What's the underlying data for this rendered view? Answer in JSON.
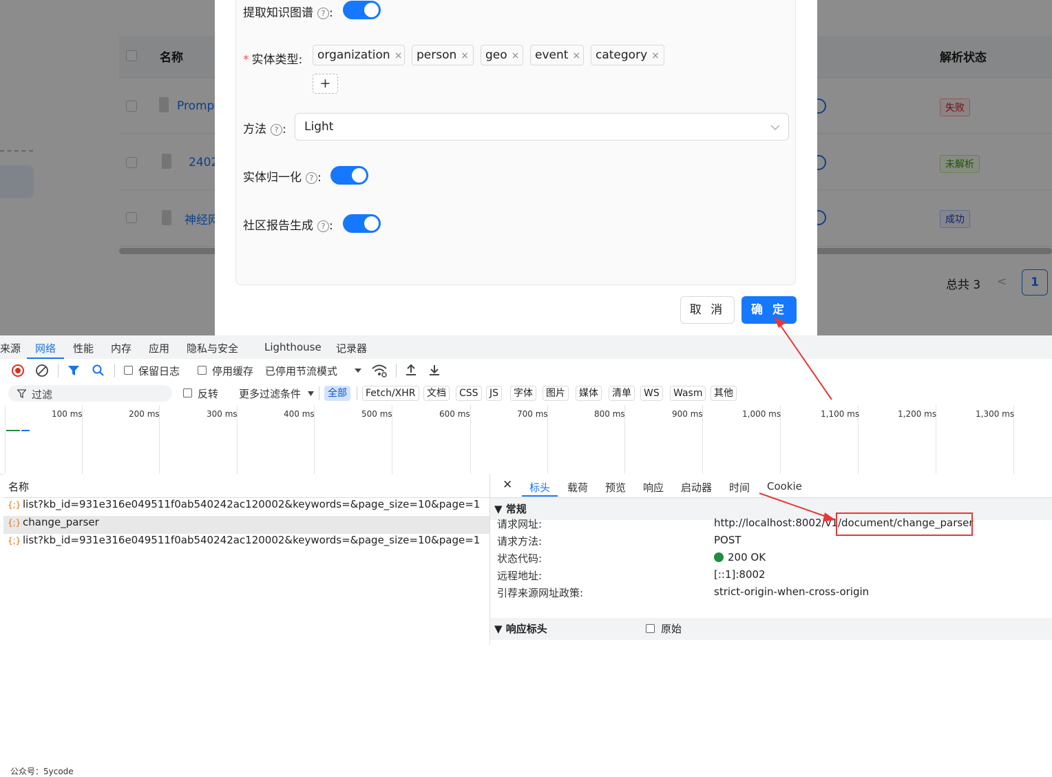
{
  "background": {
    "header": {
      "name_col": "名称",
      "status_col": "解析状态"
    },
    "rows": [
      {
        "name": "Prompt",
        "status": "失败"
      },
      {
        "name": "2402",
        "status": "未解析"
      },
      {
        "name": "神经网",
        "status": "成功"
      }
    ],
    "pager": {
      "total": "总共 3",
      "prev": "<",
      "current": "1"
    }
  },
  "modal": {
    "extract_kg": {
      "label": "提取知识图谱",
      "help": "?",
      "colon": ":",
      "enabled": true
    },
    "entity_types": {
      "label": "实体类型",
      "required": "*",
      "colon": ":",
      "tags": [
        "organization",
        "person",
        "geo",
        "event",
        "category"
      ],
      "remove_glyph": "×",
      "add_glyph": "+"
    },
    "method": {
      "label": "方法",
      "help": "?",
      "colon": ":",
      "value": "Light"
    },
    "entity_normalize": {
      "label": "实体归一化",
      "help": "?",
      "colon": ":",
      "enabled": true
    },
    "community_report": {
      "label": "社区报告生成",
      "help": "?",
      "colon": ":",
      "enabled": true
    },
    "cancel_label": "取 消",
    "ok_label": "确 定"
  },
  "devtools": {
    "tabs": [
      "来源",
      "网络",
      "性能",
      "内存",
      "应用",
      "隐私与安全",
      "Lighthouse",
      "记录器"
    ],
    "active_tab": "网络",
    "toolbar": {
      "preserve_log": "保留日志",
      "disable_cache": "停用缓存",
      "throttle": "已停用节流模式"
    },
    "filter": {
      "placeholder": "过滤",
      "invert": "反转",
      "more_filters": "更多过滤条件",
      "types": [
        "全部",
        "Fetch/XHR",
        "文档",
        "CSS",
        "JS",
        "字体",
        "图片",
        "媒体",
        "清单",
        "WS",
        "Wasm",
        "其他"
      ],
      "active_type": "全部"
    },
    "timeline_ticks": [
      "100 ms",
      "200 ms",
      "300 ms",
      "400 ms",
      "500 ms",
      "600 ms",
      "700 ms",
      "800 ms",
      "900 ms",
      "1,000 ms",
      "1,100 ms",
      "1,200 ms",
      "1,300 ms"
    ],
    "requests": {
      "header": "名称",
      "icon_glyph": "{;}",
      "rows": [
        "list?kb_id=931e316e049511f0ab540242ac120002&keywords=&page_size=10&page=1",
        "change_parser",
        "list?kb_id=931e316e049511f0ab540242ac120002&keywords=&page_size=10&page=1"
      ],
      "selected_index": 1
    },
    "detail": {
      "close_glyph": "✕",
      "tabs": [
        "标头",
        "载荷",
        "预览",
        "响应",
        "启动器",
        "时间",
        "Cookie"
      ],
      "active_tab": "标头",
      "general_title": "▼ 常规",
      "general": [
        {
          "key": "请求网址:",
          "value": "http://localhost:8002/v1/document/change_parser"
        },
        {
          "key": "请求方法:",
          "value": "POST"
        },
        {
          "key": "状态代码:",
          "value": "200 OK"
        },
        {
          "key": "远程地址:",
          "value": "[::1]:8002"
        },
        {
          "key": "引荐来源网址政策:",
          "value": "strict-origin-when-cross-origin"
        }
      ],
      "response_headers_title": "▼ 响应标头",
      "raw_label": "原始"
    },
    "watermark": "公众号：5ycode"
  }
}
